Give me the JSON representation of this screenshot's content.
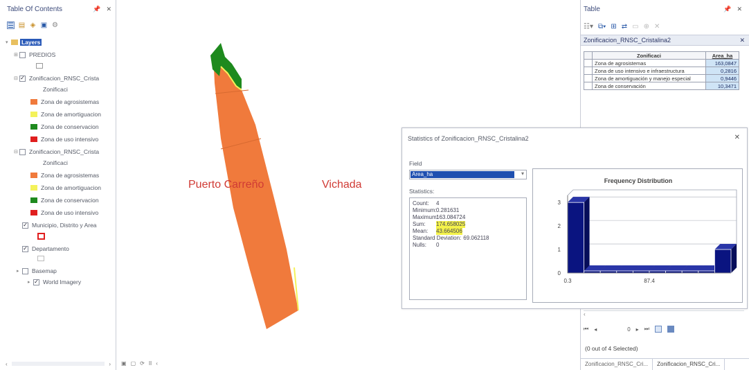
{
  "toc": {
    "title": "Table Of Contents",
    "items": [
      {
        "label": "Layers"
      },
      {
        "label": "PREDIOS"
      },
      {
        "label": "Zonificacion_RNSC_Crista"
      },
      {
        "label": "Zonificaci"
      },
      {
        "label": "Zona de agrosistemas"
      },
      {
        "label": "Zona de amortiguacion"
      },
      {
        "label": "Zona de conservacion"
      },
      {
        "label": "Zona de uso intensivo"
      },
      {
        "label": "Zonificacion_RNSC_Crista"
      },
      {
        "label": "Zonificaci"
      },
      {
        "label": "Zona de agrosistemas"
      },
      {
        "label": "Zona de amortiguacion"
      },
      {
        "label": "Zona de conservacion"
      },
      {
        "label": "Zona de uso intensivo"
      },
      {
        "label": "Municipio, Distrito y Area"
      },
      {
        "label": "Departamento"
      },
      {
        "label": "Basemap"
      },
      {
        "label": "World Imagery"
      }
    ]
  },
  "map": {
    "labels": {
      "puerto": "Puerto Carreño",
      "vichada": "Vichada"
    }
  },
  "table_window": {
    "title": "Table",
    "tab_name": "Zonificacion_RNSC_Cristalina2",
    "columns": [
      "Zonificaci",
      "Area_ha"
    ],
    "rows": [
      {
        "zona": "Zona de agrosistemas",
        "area": "163,0847"
      },
      {
        "zona": "Zona de uso intensivo e infraestructura",
        "area": "0,2816"
      },
      {
        "zona": "Zona de amortiguación y manejo especial",
        "area": "0,9446"
      },
      {
        "zona": "Zona de conservación",
        "area": "10,3471"
      }
    ],
    "nav_value": "0",
    "selected_text": "(0 out of 4 Selected)",
    "tabs": [
      "Zonificacion_RNSC_Cri...",
      "Zonificacion_RNSC_Cri..."
    ]
  },
  "stats_dialog": {
    "title": "Statistics of Zonificacion_RNSC_Cristalina2",
    "field_label": "Field",
    "field_value": "Area_ha",
    "statistics_label": "Statistics:",
    "stats": [
      {
        "key": "Count:",
        "value": "4"
      },
      {
        "key": "Minimum:",
        "value": "0.281631"
      },
      {
        "key": "Maximum:",
        "value": "163.084724"
      },
      {
        "key": "Sum:",
        "value": "174.658025"
      },
      {
        "key": "Mean:",
        "value": "43.664506"
      },
      {
        "key": "Standard Deviation:",
        "value": "69.062118"
      },
      {
        "key": "Nulls:",
        "value": "0"
      }
    ]
  },
  "chart_data": {
    "type": "bar",
    "title": "Frequency Distribution",
    "categories": [
      "0.3",
      "",
      "",
      "",
      "",
      "",
      "",
      "",
      "",
      ""
    ],
    "values": [
      3,
      0,
      0,
      0,
      0,
      0,
      0,
      0,
      0,
      1
    ],
    "x_tick_labels": [
      "0.3",
      "87.4"
    ],
    "y_ticks": [
      0,
      1,
      2,
      3
    ],
    "ylim": [
      0,
      3.3
    ],
    "bar_color": "#0a1480",
    "grid": true
  },
  "colors": {
    "agrosistemas": "#f07a3c",
    "amortiguacion": "#f4f25a",
    "conservacion": "#1e8a1e",
    "uso_intensivo": "#e01e1e",
    "map_label": "#d03a34",
    "selection": "#1e4fb0",
    "highlight": "#f4f24a"
  }
}
